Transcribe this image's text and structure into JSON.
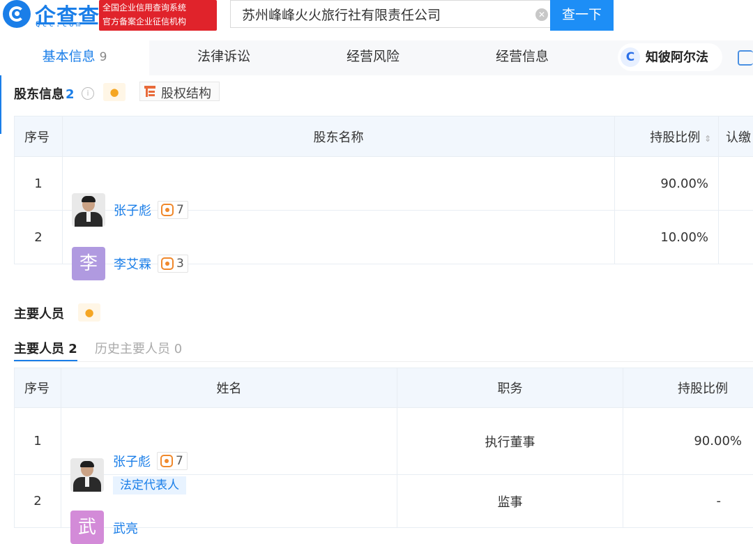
{
  "header": {
    "logo_name": "企查查",
    "logo_sub": "Qcc.com",
    "cert_line1": "全国企业信用查询系统",
    "cert_line2": "官方备案企业征信机构",
    "search_value": "苏州峰峰火火旅行社有限责任公司",
    "search_button": "查一下"
  },
  "tabs": [
    {
      "label": "基本信息",
      "count": "9"
    },
    {
      "label": "法律诉讼"
    },
    {
      "label": "经营风险"
    },
    {
      "label": "经营信息"
    }
  ],
  "alpha_label": "知彼阿尔法",
  "shareholders": {
    "title": "股东信息",
    "count": "2",
    "equity_button": "股权结构",
    "columns": [
      "序号",
      "股东名称",
      "持股比例",
      "认缴"
    ],
    "rows": [
      {
        "no": "1",
        "name": "张子彪",
        "avatar": "photo",
        "ent_count": "7",
        "ratio": "90.00%"
      },
      {
        "no": "2",
        "name": "李艾霖",
        "avatar": "李",
        "avatar_color": "#b09ae0",
        "ent_count": "3",
        "ratio": "10.00%"
      }
    ]
  },
  "personnel": {
    "title": "主要人员",
    "subtab_active": "主要人员 2",
    "subtab_history": "历史主要人员 0",
    "columns": [
      "序号",
      "姓名",
      "职务",
      "持股比例"
    ],
    "rows": [
      {
        "no": "1",
        "name": "张子彪",
        "avatar": "photo",
        "ent_count": "7",
        "tag": "法定代表人",
        "role": "执行董事",
        "ratio": "90.00%"
      },
      {
        "no": "2",
        "name": "武亮",
        "avatar": "武",
        "avatar_color": "#d38bd8",
        "role": "监事",
        "ratio": "-"
      }
    ]
  }
}
